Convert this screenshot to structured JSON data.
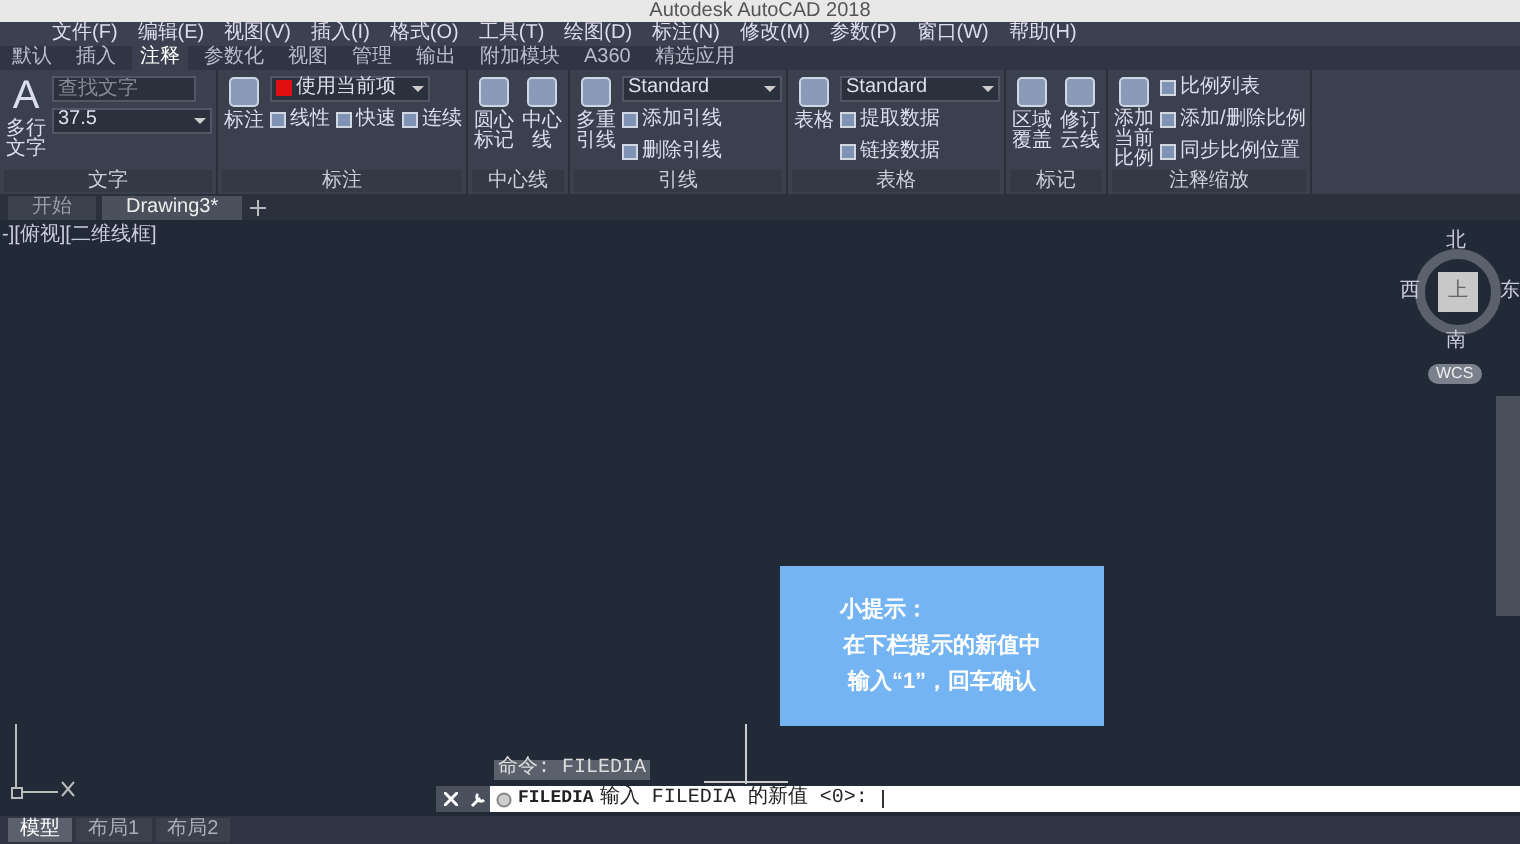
{
  "window": {
    "title": "Autodesk AutoCAD 2018"
  },
  "menu_bar": [
    "文件(F)",
    "编辑(E)",
    "视图(V)",
    "插入(I)",
    "格式(O)",
    "工具(T)",
    "绘图(D)",
    "标注(N)",
    "修改(M)",
    "参数(P)",
    "窗口(W)",
    "帮助(H)"
  ],
  "ribbon_tabs": [
    {
      "label": "默认",
      "selected": false
    },
    {
      "label": "插入",
      "selected": false
    },
    {
      "label": "注释",
      "selected": true
    },
    {
      "label": "参数化",
      "selected": false
    },
    {
      "label": "视图",
      "selected": false
    },
    {
      "label": "管理",
      "selected": false
    },
    {
      "label": "输出",
      "selected": false
    },
    {
      "label": "附加模块",
      "selected": false
    },
    {
      "label": "A360",
      "selected": false
    },
    {
      "label": "精选应用",
      "selected": false
    }
  ],
  "ribbon_panels": [
    {
      "title": "文字",
      "large": [
        {
          "label": "多行文字",
          "glyph": "A"
        }
      ],
      "rows": [
        [
          {
            "kind": "field",
            "placeholder": "查找文字"
          }
        ],
        [
          {
            "kind": "dropdown",
            "value": "37.5"
          }
        ]
      ]
    },
    {
      "title": "标注",
      "large": [
        {
          "label": "标注"
        }
      ],
      "rows": [
        [
          {
            "kind": "dropdown",
            "value": "使用当前项",
            "color": "#e01010"
          }
        ],
        [
          {
            "kind": "button",
            "label": "线性"
          },
          {
            "kind": "button",
            "label": "快速"
          },
          {
            "kind": "button",
            "label": "连续"
          }
        ]
      ]
    },
    {
      "title": "中心线",
      "large": [
        {
          "label": "圆心标记"
        },
        {
          "label": "中心线"
        }
      ]
    },
    {
      "title": "引线",
      "large": [
        {
          "label": "多重引线"
        }
      ],
      "rows": [
        [
          {
            "kind": "dropdown",
            "value": "Standard"
          }
        ],
        [
          {
            "kind": "button",
            "label": "添加引线"
          }
        ],
        [
          {
            "kind": "button",
            "label": "删除引线"
          }
        ]
      ]
    },
    {
      "title": "表格",
      "large": [
        {
          "label": "表格"
        }
      ],
      "rows": [
        [
          {
            "kind": "dropdown",
            "value": "Standard"
          }
        ],
        [
          {
            "kind": "button",
            "label": "提取数据"
          }
        ],
        [
          {
            "kind": "button",
            "label": "链接数据"
          }
        ]
      ]
    },
    {
      "title": "标记",
      "large": [
        {
          "label": "区域覆盖"
        },
        {
          "label": "修订云线"
        }
      ]
    },
    {
      "title": "注释缩放",
      "large": [
        {
          "label": "添加当前比例"
        }
      ],
      "rows": [
        [
          {
            "kind": "button",
            "label": "比例列表"
          }
        ],
        [
          {
            "kind": "button",
            "label": "添加/删除比例"
          }
        ],
        [
          {
            "kind": "button",
            "label": "同步比例位置"
          }
        ]
      ]
    }
  ],
  "file_tabs": [
    {
      "label": "开始",
      "selected": false
    },
    {
      "label": "Drawing3*",
      "selected": true
    }
  ],
  "viewport_label": "-][俯视][二维线框]",
  "viewcube": {
    "north": "北",
    "west": "西",
    "top": "上",
    "east": "东",
    "south": "南",
    "ucs": "WCS"
  },
  "tip": {
    "title": "小提示：",
    "lines": [
      "在下栏提示的新值中",
      "输入“1”，回车确认"
    ]
  },
  "command_history": "命令: FILEDIA",
  "command_line": {
    "command": "FILEDIA",
    "prompt": "输入 FILEDIA 的新值 <0>:"
  },
  "layout_tabs": [
    {
      "label": "模型",
      "selected": true
    },
    {
      "label": "布局1",
      "selected": false
    },
    {
      "label": "布局2",
      "selected": false
    }
  ]
}
